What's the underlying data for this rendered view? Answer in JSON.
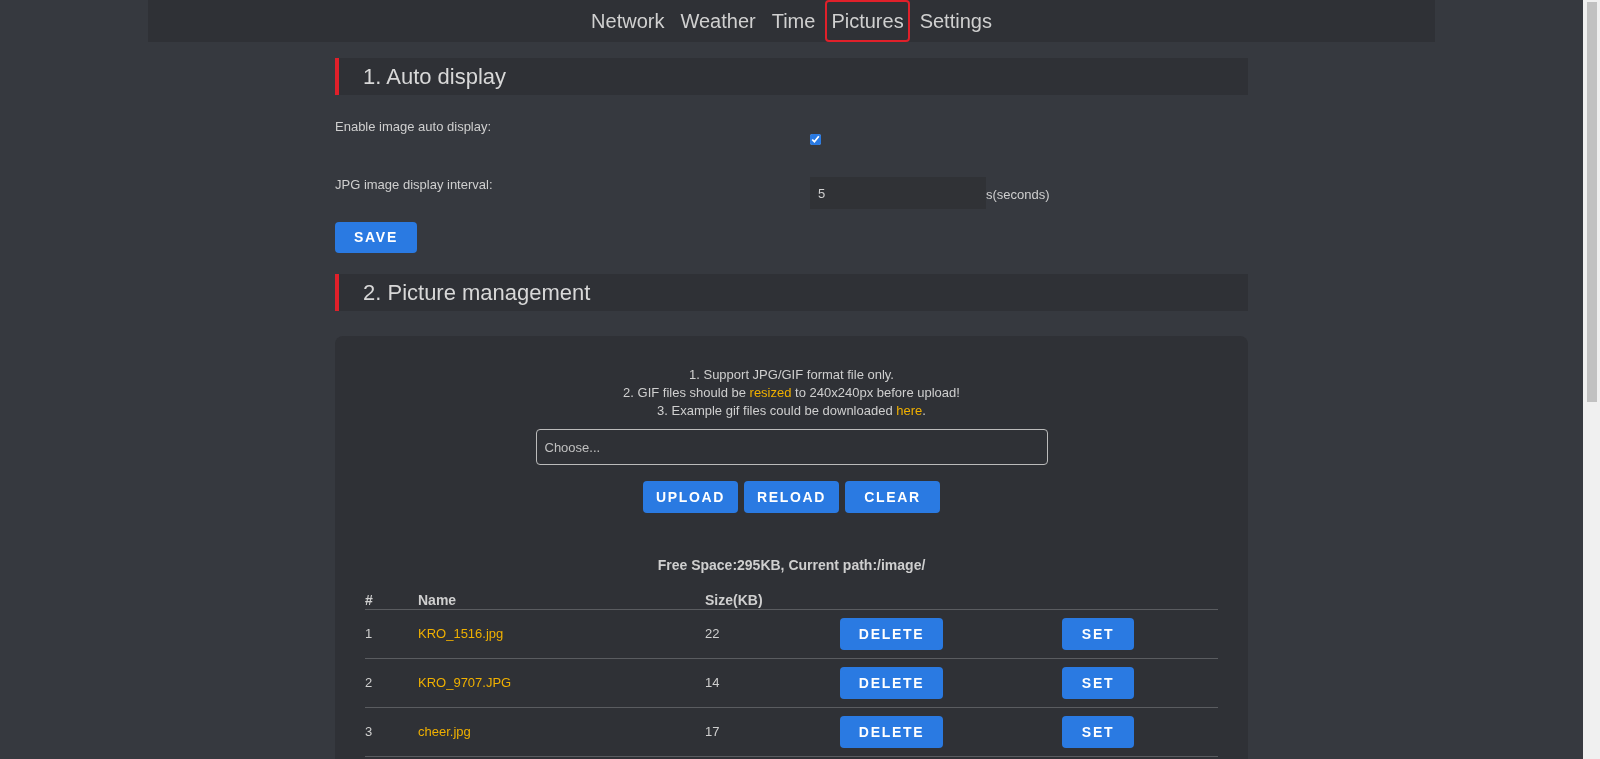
{
  "nav": [
    {
      "label": "Network",
      "selected": false
    },
    {
      "label": "Weather",
      "selected": false
    },
    {
      "label": "Time",
      "selected": false
    },
    {
      "label": "Pictures",
      "selected": true
    },
    {
      "label": "Settings",
      "selected": false
    }
  ],
  "auto_display": {
    "title": "1. Auto display",
    "enable_label": "Enable image auto display:",
    "enabled": true,
    "interval_label": "JPG image display interval:",
    "interval_value": "5",
    "interval_unit": "s(seconds)",
    "save": "SAVE"
  },
  "management": {
    "title": "2. Picture management",
    "notes": [
      {
        "before": "1. Support JPG/GIF format file only."
      },
      {
        "before": "2. GIF files should be ",
        "link": "resized",
        "after": " to 240x240px before upload!"
      },
      {
        "before": "3. Example gif files could be downloaded ",
        "link": "here",
        "after": "."
      }
    ],
    "file_placeholder": "Choose...",
    "buttons": [
      "UPLOAD",
      "RELOAD",
      "CLEAR"
    ],
    "free_space": "Free Space:295KB, Current path:/image/",
    "columns": [
      "#",
      "Name",
      "Size(KB)"
    ],
    "rows": [
      {
        "index": "1",
        "name": "KRO_1516.jpg",
        "size": "22",
        "delete": "DELETE",
        "set": "SET"
      },
      {
        "index": "2",
        "name": "KRO_9707.JPG",
        "size": "14",
        "delete": "DELETE",
        "set": "SET"
      },
      {
        "index": "3",
        "name": "cheer.jpg",
        "size": "17",
        "delete": "DELETE",
        "set": "SET"
      }
    ]
  }
}
